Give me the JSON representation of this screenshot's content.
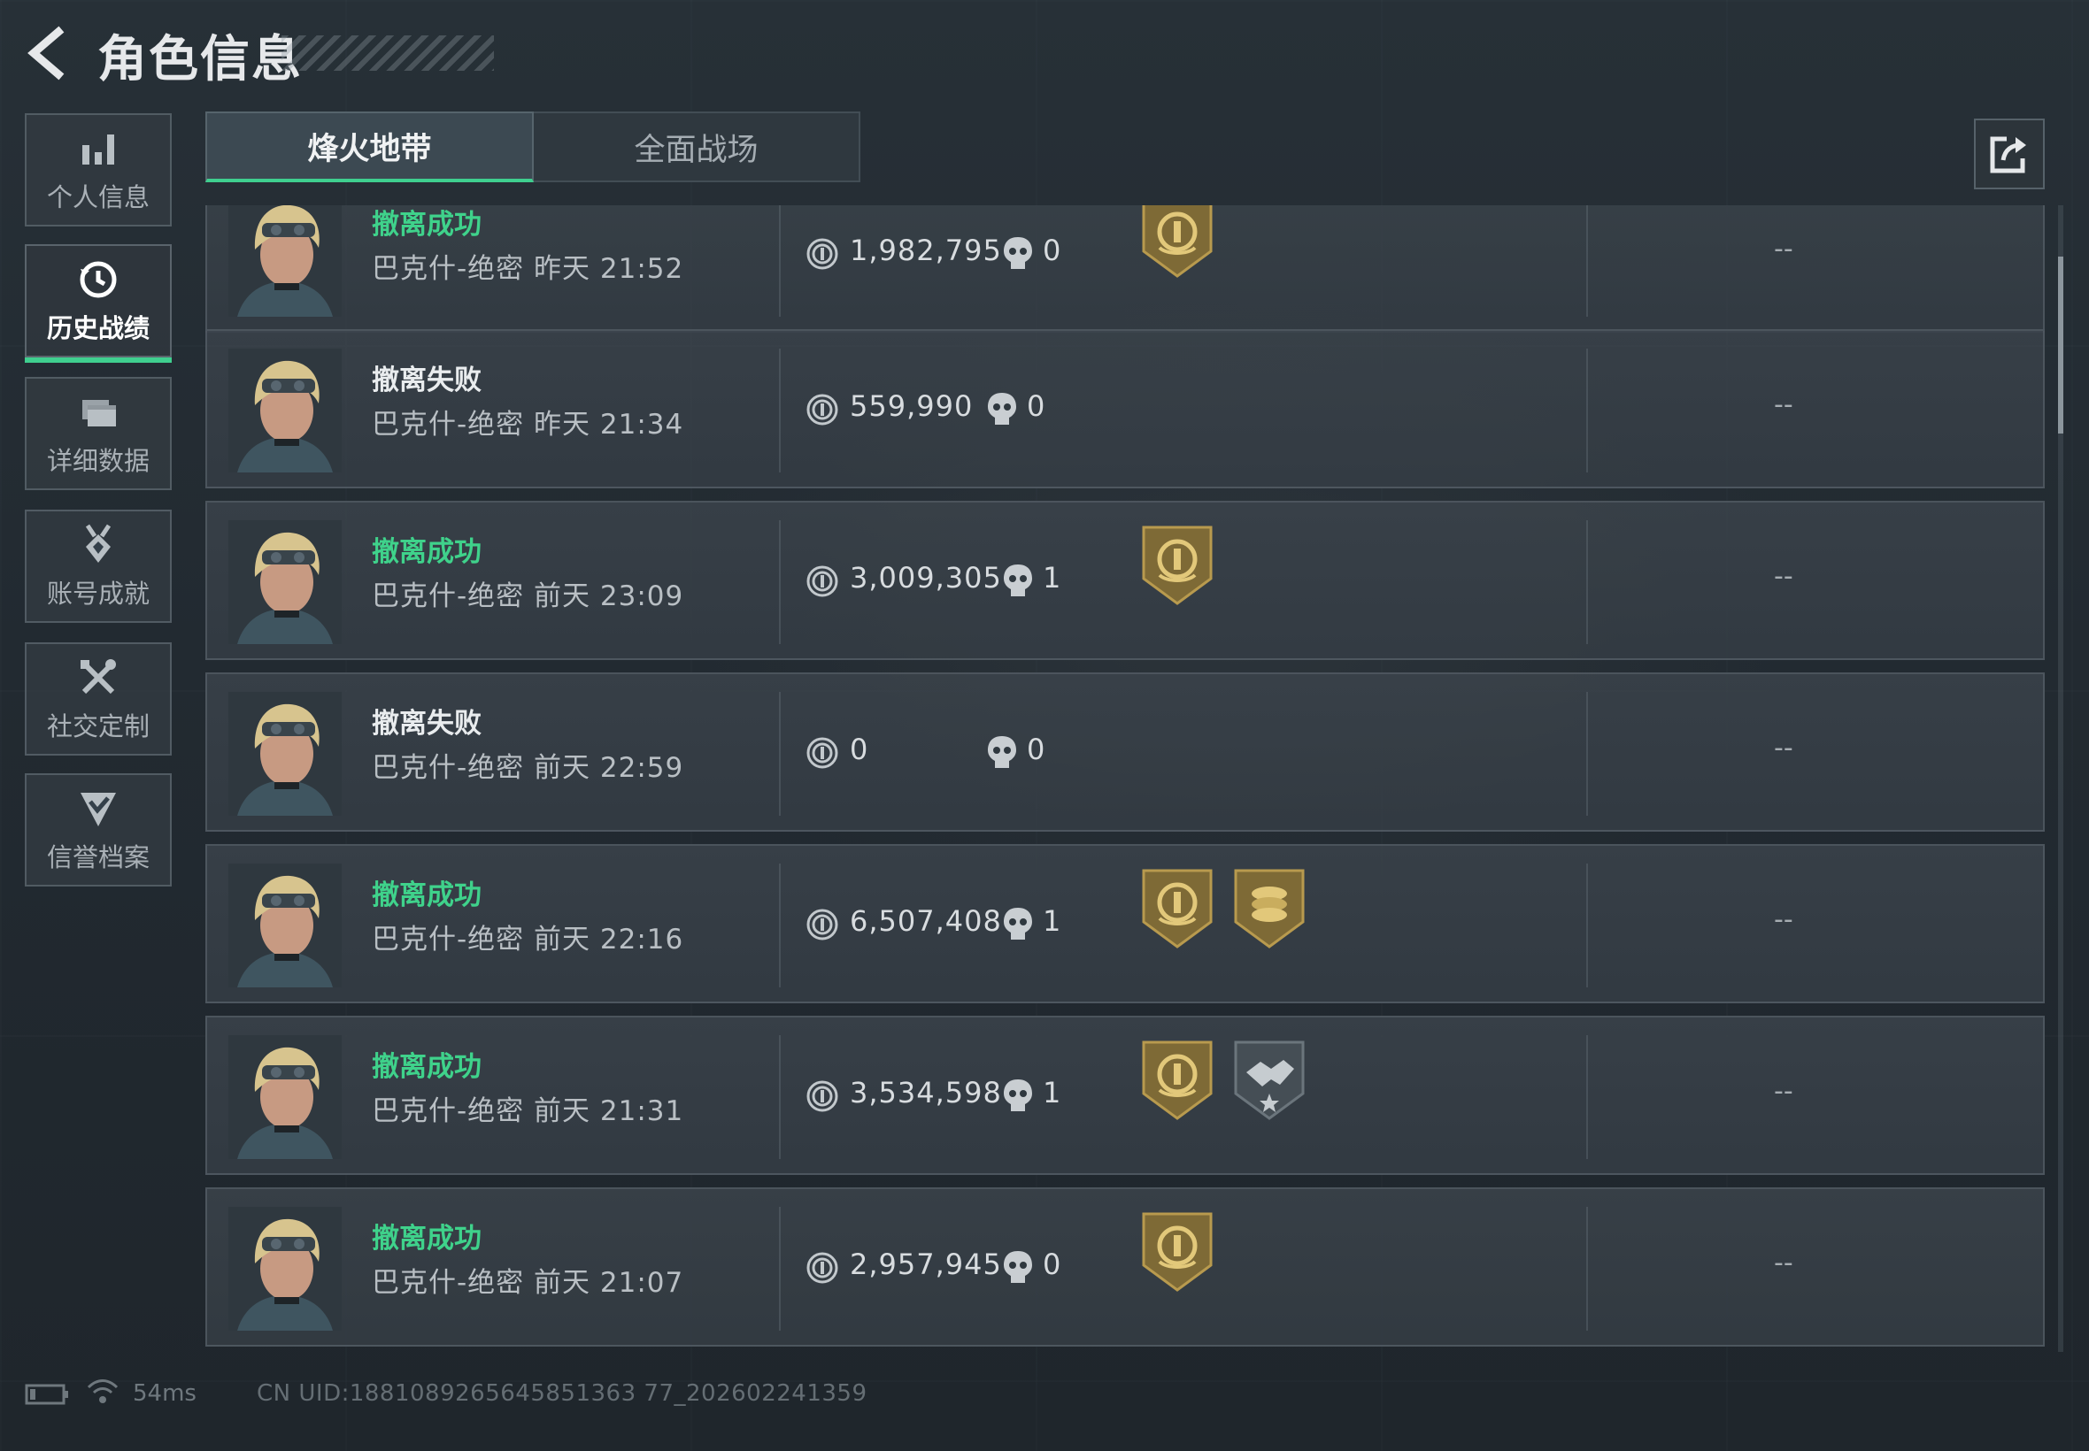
{
  "header": {
    "title": "角色信息"
  },
  "sidebar": {
    "items": [
      {
        "label": "个人信息",
        "icon": "bar-chart-icon"
      },
      {
        "label": "历史战绩",
        "icon": "history-clock-icon",
        "active": true
      },
      {
        "label": "详细数据",
        "icon": "folder-icon"
      },
      {
        "label": "账号成就",
        "icon": "medal-icon"
      },
      {
        "label": "社交定制",
        "icon": "tools-icon"
      },
      {
        "label": "信誉档案",
        "icon": "shield-check-icon"
      }
    ]
  },
  "tabs": [
    {
      "label": "烽火地带",
      "active": true
    },
    {
      "label": "全面战场",
      "active": false
    }
  ],
  "matches": [
    {
      "status": "撤离成功",
      "result": "success",
      "map": "巴克什-绝密",
      "time": "昨天 21:52",
      "value": "1,982,795",
      "kills": "0",
      "badges": [
        "gold-emblem-badge-icon"
      ],
      "rating": "--"
    },
    {
      "status": "撤离失败",
      "result": "fail",
      "map": "巴克什-绝密",
      "time": "昨天 21:34",
      "value": "559,990",
      "kills": "0",
      "badges": [],
      "rating": "--"
    },
    {
      "status": "撤离成功",
      "result": "success",
      "map": "巴克什-绝密",
      "time": "前天 23:09",
      "value": "3,009,305",
      "kills": "1",
      "badges": [
        "gold-emblem-badge-icon"
      ],
      "rating": "--"
    },
    {
      "status": "撤离失败",
      "result": "fail",
      "map": "巴克什-绝密",
      "time": "前天 22:59",
      "value": "0",
      "kills": "0",
      "badges": [],
      "rating": "--"
    },
    {
      "status": "撤离成功",
      "result": "success",
      "map": "巴克什-绝密",
      "time": "前天 22:16",
      "value": "6,507,408",
      "kills": "1",
      "badges": [
        "gold-emblem-badge-icon",
        "gold-coins-badge-icon"
      ],
      "rating": "--"
    },
    {
      "status": "撤离成功",
      "result": "success",
      "map": "巴克什-绝密",
      "time": "前天 21:31",
      "value": "3,534,598",
      "kills": "1",
      "badges": [
        "gold-emblem-badge-icon",
        "handshake-badge-icon"
      ],
      "rating": "--"
    },
    {
      "status": "撤离成功",
      "result": "success",
      "map": "巴克什-绝密",
      "time": "前天 21:07",
      "value": "2,957,945",
      "kills": "0",
      "badges": [
        "gold-emblem-badge-icon"
      ],
      "rating": "--"
    }
  ],
  "footer": {
    "ping": "54ms",
    "uid": "CN UID:1881089265645851363 77_202602241359"
  },
  "colors": {
    "success": "#3fd28b",
    "accent": "#3fcf8f",
    "badge_gold": "#b89a4e"
  }
}
